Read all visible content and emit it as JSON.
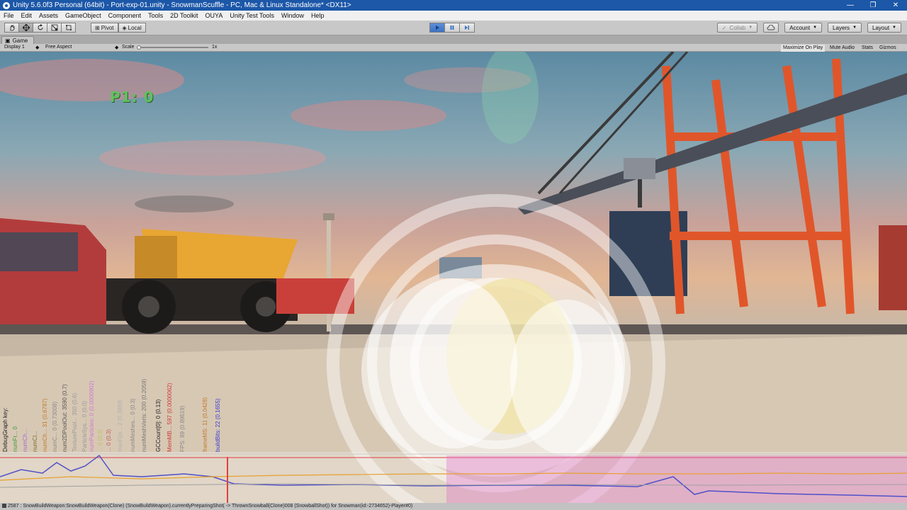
{
  "window": {
    "title": "Unity 5.6.0f3 Personal (64bit) - Port-exp-01.unity - SnowmanScuffle - PC, Mac & Linux Standalone* <DX11>",
    "controls": [
      "—",
      "❐",
      "✕"
    ]
  },
  "menu": [
    "File",
    "Edit",
    "Assets",
    "GameObject",
    "Component",
    "Tools",
    "2D Toolkit",
    "OUYA",
    "Unity Test Tools",
    "Window",
    "Help"
  ],
  "toolbar": {
    "tools": [
      "hand-icon",
      "move-icon",
      "rotate-icon",
      "scale-icon",
      "rect-icon"
    ],
    "pivot_label": "Pivot",
    "local_label": "Local",
    "play_state": "playing",
    "collab_label": "Collab",
    "account_label": "Account",
    "layers_label": "Layers",
    "layout_label": "Layout"
  },
  "game_tab": {
    "label": "Game",
    "display": "Display 1",
    "aspect": "Free Aspect",
    "scale_label": "Scale",
    "scale_value": "1x",
    "maximize_on_play": "Maximize On Play",
    "mute_audio": "Mute Audio",
    "stats": "Stats",
    "gizmos": "Gizmos"
  },
  "hud": {
    "score": "P1: 0"
  },
  "debug_graph": {
    "labels": [
      {
        "text": "DebugGraph key:",
        "color": "#222222"
      },
      {
        "text": "numFr... 0",
        "color": "#3a9a3a"
      },
      {
        "text": "numCh...",
        "color": "#a26ad0"
      },
      {
        "text": "numCl...",
        "color": "#7a6a2a"
      },
      {
        "text": "numCh... 31 (0.6787)",
        "color": "#c07a2a"
      },
      {
        "text": "numC... 0 (0.73008)",
        "color": "#8a8a8a"
      },
      {
        "text": "num2DPoolOut: 3590 (0.7)",
        "color": "#555555"
      },
      {
        "text": "TexturePool... 350 (0.6)",
        "color": "#9a9a9a"
      },
      {
        "text": "ParticleSys... 0 (0.0)",
        "color": "#9a9a9a"
      },
      {
        "text": "numParticles: 0 (0.0000902)",
        "color": "#d07ad0"
      },
      {
        "text": "... 0 (0.3)",
        "color": "#c0c060"
      },
      {
        "text": "... 0 (0.3)",
        "color": "#c06060"
      },
      {
        "text": "maxFps... 2 (0.3989)",
        "color": "#b0b0b0"
      },
      {
        "text": "numMeshes... 0 (0.3)",
        "color": "#888888"
      },
      {
        "text": "numMeshVerts: 200 (0.2059)",
        "color": "#777777"
      },
      {
        "text": "GCCount[0]: 0 (0.13)",
        "color": "#222222"
      },
      {
        "text": "MemMB... 597 (0.0000062)",
        "color": "#d03a3a"
      },
      {
        "text": "FPS: 89 (0.89619)",
        "color": "#888888"
      },
      {
        "text": "frameMS: 11 (0.0428)",
        "color": "#c07a2a"
      },
      {
        "text": "buildBits: 22 (0.1655)",
        "color": "#3a3ad0"
      }
    ]
  },
  "status": {
    "message": "2587 : SnowBuildWeapon:SnowBuildWeapon(Clone) (SnowBuildWeapon).currentlyPreparingShot( -> ThrownSnowball(Clone)008 (SnowballShot)) for Snowman(id:-2734652)-Player#0)"
  }
}
